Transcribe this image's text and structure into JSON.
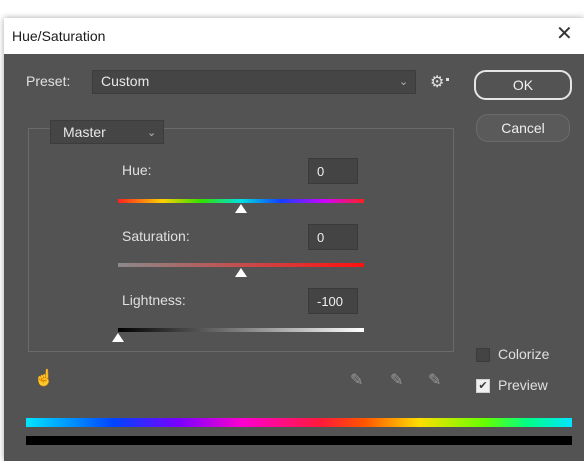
{
  "window": {
    "title": "Hue/Saturation",
    "close_glyph": "✕"
  },
  "preset": {
    "label": "Preset:",
    "value": "Custom"
  },
  "buttons": {
    "ok": "OK",
    "cancel": "Cancel"
  },
  "channel": {
    "value": "Master"
  },
  "hue": {
    "label": "Hue:",
    "value": "0",
    "slider_fraction": 0.5
  },
  "saturation": {
    "label": "Saturation:",
    "value": "0",
    "slider_fraction": 0.5
  },
  "lightness": {
    "label": "Lightness:",
    "value": "-100",
    "slider_fraction": 0.0
  },
  "options": {
    "colorize": {
      "label": "Colorize",
      "checked": false
    },
    "preview": {
      "label": "Preview",
      "checked": true
    }
  },
  "icons": {
    "settings": "gear-icon",
    "target_adjust": "hand-icon",
    "droppers": [
      "eyedropper-icon",
      "eyedropper-plus-icon",
      "eyedropper-minus-icon"
    ]
  },
  "colors": {
    "dialog_bg": "#535353",
    "field_bg": "#444444",
    "text": "#e0e0e0"
  }
}
